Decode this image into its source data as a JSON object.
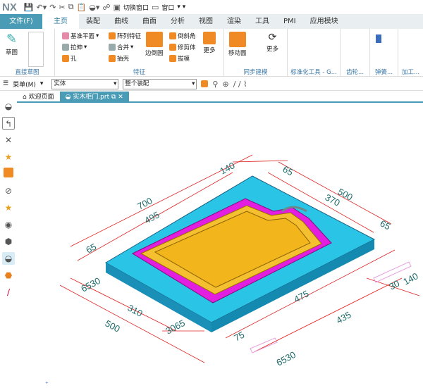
{
  "app": {
    "logo": "NX",
    "switch_window": "切换窗口",
    "window": "窗口"
  },
  "tabs": [
    "文件(F)",
    "主页",
    "装配",
    "曲线",
    "曲面",
    "分析",
    "视图",
    "渲染",
    "工具",
    "PMI",
    "应用模块"
  ],
  "ribbon": {
    "sketch": "草图",
    "direct_sketch": "直接草图",
    "datum_plane": "基准平面",
    "extrude": "拉伸",
    "hole": "孔",
    "pattern": "阵列特征",
    "unite": "合并",
    "shell": "抽壳",
    "edge_blend": "边倒圆",
    "chamfer": "倒斜角",
    "trim_body": "修剪体",
    "draft": "拔模",
    "more": "更多",
    "feature": "特征",
    "move_face": "移动面",
    "more2": "更多",
    "sync": "同步建模",
    "std_tools": "标准化工具 - G...",
    "gear": "齿轮...",
    "spring": "弹簧...",
    "machining": "加工..."
  },
  "toolbar2": {
    "menu": "菜单(M)",
    "filter": "实体",
    "scope": "整个装配"
  },
  "doc_tabs": [
    "欢迎页面",
    "实木柜门.prt"
  ],
  "dims": {
    "d140a": "140",
    "d65a": "65",
    "d500a": "500",
    "d370": "370",
    "d65b": "65",
    "d700": "700",
    "d495": "495",
    "d65c": "65",
    "d6530a": "6530",
    "d310": "310",
    "d500b": "500",
    "d3065": "3065",
    "d475": "475",
    "d435": "435",
    "d75": "75",
    "d6530b": "6530",
    "d30": "30",
    "d140b": "140"
  },
  "colors": {
    "slab": "#29c4e6",
    "frame": "#e21ee0",
    "panel": "#f2b51c",
    "dim": "#e02020"
  }
}
